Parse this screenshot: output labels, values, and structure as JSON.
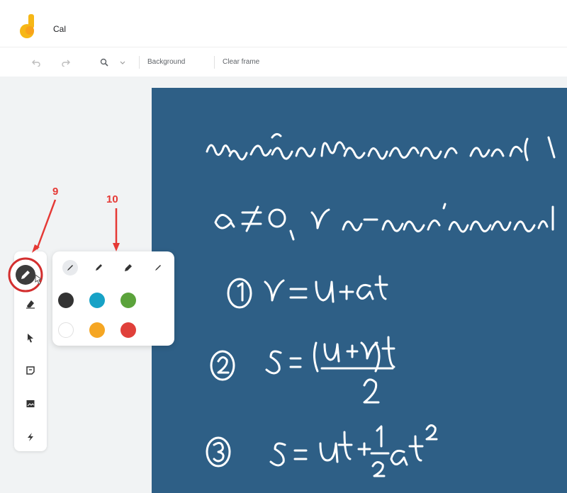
{
  "app": {
    "title": "Cal"
  },
  "toolbar": {
    "undo_icon": "undo-icon",
    "redo_icon": "redo-icon",
    "zoom_icon": "zoom-icon",
    "background_label": "Background",
    "clear_frame_label": "Clear frame"
  },
  "rail": {
    "tools": [
      "pen-icon",
      "eraser-icon",
      "select-arrow-icon",
      "sticky-note-icon",
      "image-icon",
      "laser-icon"
    ]
  },
  "pen_popup": {
    "pens": [
      "pen-thin-icon",
      "pen-medium-icon",
      "marker-icon",
      "highlighter-icon"
    ],
    "colors": [
      "#333333",
      "#17a2c6",
      "#5ba33b",
      "#ffffff",
      "#f5a623",
      "#e0403a"
    ]
  },
  "annotations": {
    "label_9": "9",
    "label_10": "10"
  },
  "colors": {
    "canvas": "#2e5f86",
    "annotation": "#e53935"
  }
}
